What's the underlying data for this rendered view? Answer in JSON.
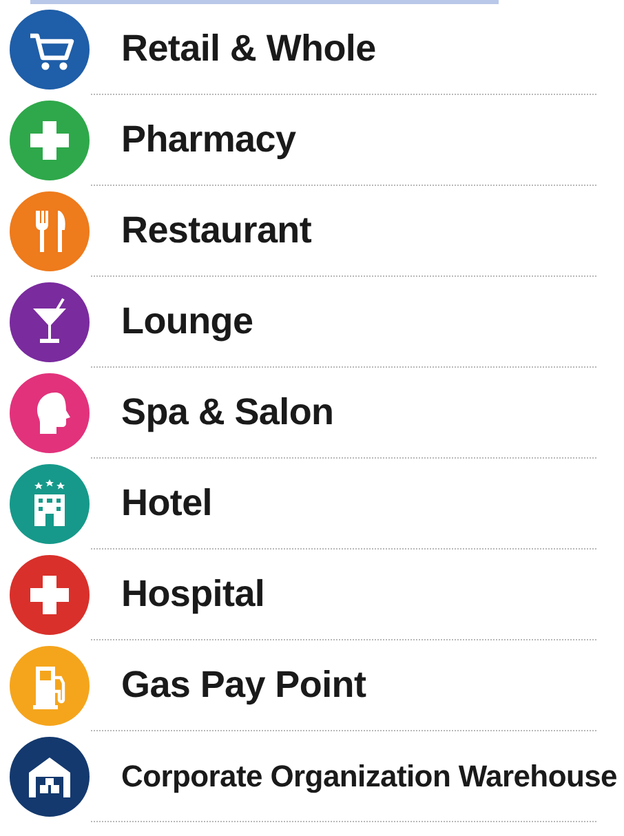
{
  "categories": [
    {
      "label": "Retail & Whole",
      "kind": "cart",
      "color": "#1f5ea8"
    },
    {
      "label": "Pharmacy",
      "kind": "cross",
      "color": "#2ea84a"
    },
    {
      "label": "Restaurant",
      "kind": "cutlery",
      "color": "#ee7b1c"
    },
    {
      "label": "Lounge",
      "kind": "cocktail",
      "color": "#7a2b9e"
    },
    {
      "label": "Spa & Salon",
      "kind": "head",
      "color": "#e2327c"
    },
    {
      "label": "Hotel",
      "kind": "hotel",
      "color": "#16998a"
    },
    {
      "label": "Hospital",
      "kind": "cross",
      "color": "#d9302b"
    },
    {
      "label": "Gas Pay Point",
      "kind": "fuel",
      "color": "#f5a51c"
    },
    {
      "label": "Corporate Organization Warehouse",
      "kind": "warehouse",
      "color": "#14396e"
    }
  ]
}
